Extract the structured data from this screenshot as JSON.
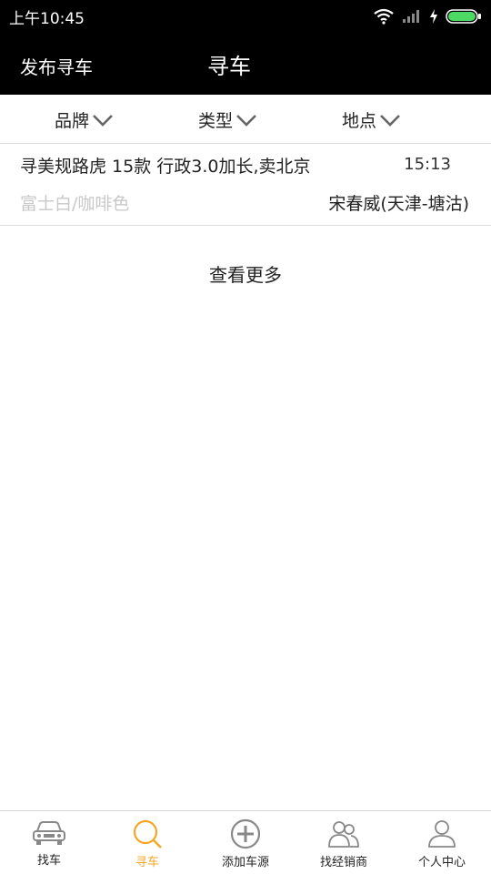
{
  "status": {
    "time": "上午10:45"
  },
  "header": {
    "publish_label": "发布寻车",
    "title": "寻车"
  },
  "filters": [
    {
      "label": "品牌"
    },
    {
      "label": "类型"
    },
    {
      "label": "地点"
    }
  ],
  "listing": {
    "title": "寻美规路虎 15款 行政3.0加长,卖北京",
    "time": "15:13",
    "color": "富士白/咖啡色",
    "seller": "宋春威(天津-塘沽)"
  },
  "more_label": "查看更多",
  "tabs": [
    {
      "label": "找车",
      "icon": "car-icon"
    },
    {
      "label": "寻车",
      "icon": "search-icon",
      "active": true
    },
    {
      "label": "添加车源",
      "icon": "add-circle-icon"
    },
    {
      "label": "找经销商",
      "icon": "dealers-icon"
    },
    {
      "label": "个人中心",
      "icon": "person-icon"
    }
  ],
  "colors": {
    "accent": "#f5a623",
    "header_bg": "#000000",
    "muted_text": "#c8c8c8"
  }
}
